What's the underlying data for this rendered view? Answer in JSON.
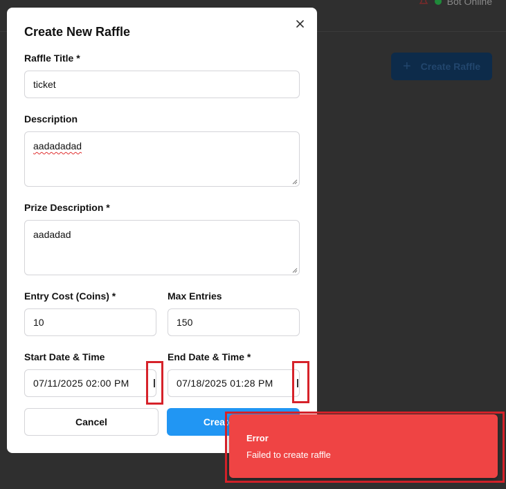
{
  "background": {
    "status_text": "Bot Online",
    "create_button_label": "Create Raffle",
    "create_button_icon": "plus-icon"
  },
  "modal": {
    "title": "Create New Raffle",
    "close_icon": "close-icon",
    "fields": {
      "title": {
        "label": "Raffle Title *",
        "value": "ticket"
      },
      "description": {
        "label": "Description",
        "value": "aadadadad"
      },
      "prize": {
        "label": "Prize Description *",
        "value": "aadadad"
      },
      "entry_cost": {
        "label": "Entry Cost (Coins) *",
        "value": "10"
      },
      "max_entries": {
        "label": "Max Entries",
        "value": "150"
      },
      "start": {
        "label": "Start Date & Time",
        "value": "07/11/2025 02:00 PM"
      },
      "end": {
        "label": "End Date & Time *",
        "value": "07/18/2025 01:28 PM"
      }
    },
    "buttons": {
      "cancel": "Cancel",
      "create": "Create Raffle"
    }
  },
  "toast": {
    "title": "Error",
    "message": "Failed to create raffle"
  },
  "colors": {
    "primary": "#2196f3",
    "error": "#ef4444",
    "highlight": "#d6222a",
    "online": "#1f8a3a"
  }
}
